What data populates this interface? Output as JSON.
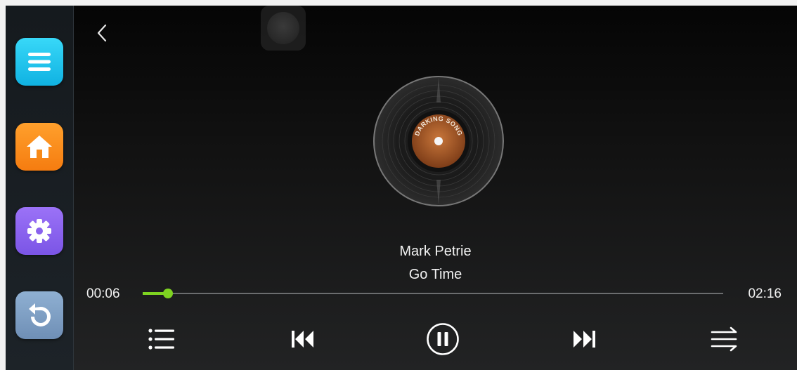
{
  "sidebar": {
    "items": [
      {
        "name": "menu-icon",
        "color": "#1fc6ef"
      },
      {
        "name": "home-icon",
        "color": "#ff8a1c"
      },
      {
        "name": "gear-icon",
        "color": "#8c63f2"
      },
      {
        "name": "return-icon",
        "color": "#7ea0c4"
      }
    ]
  },
  "header": {
    "back_icon": "chevron-left-icon"
  },
  "album": {
    "label_text": "DARKING SONG"
  },
  "track": {
    "artist": "Mark Petrie",
    "title": "Go Time",
    "elapsed": "00:06",
    "total": "02:16",
    "progress": 0.044
  },
  "controls": {
    "playlist": "playlist-icon",
    "previous": "skip-previous-icon",
    "play_pause": "pause-icon",
    "next": "skip-next-icon",
    "mode": "shuffle-order-icon"
  },
  "colors": {
    "accent": "#7ed321"
  }
}
